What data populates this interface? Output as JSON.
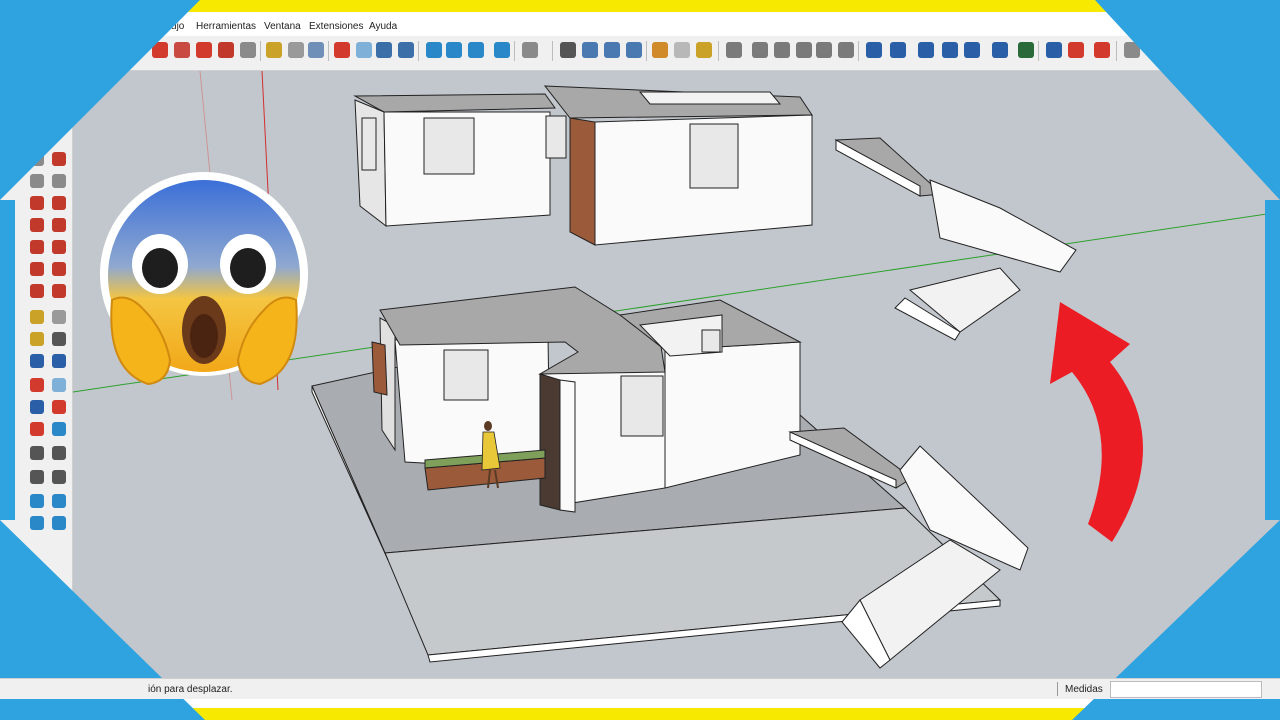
{
  "menu": {
    "items": [
      "Dibujo",
      "Herramientas",
      "Ventana",
      "Extensiones",
      "Ayuda"
    ]
  },
  "status": {
    "text": "ión para desplazar.",
    "measurements_label": "Medidas",
    "measurements_value": ""
  },
  "colors": {
    "frame_blue": "#2ea3df",
    "frame_yellow": "#f7ea00",
    "viewport_sky": "#c2c7cd",
    "arrow_red": "#ec1c24",
    "wall_white": "#fafafa",
    "roof_gray": "#a8a8a8",
    "brick": "#9b5a3a",
    "axis_green": "#2ea02e",
    "axis_red": "#d03030"
  },
  "icons": {
    "overlay_emoji": "screaming-face-emoji",
    "overlay_arrow": "curved-up-arrow"
  }
}
